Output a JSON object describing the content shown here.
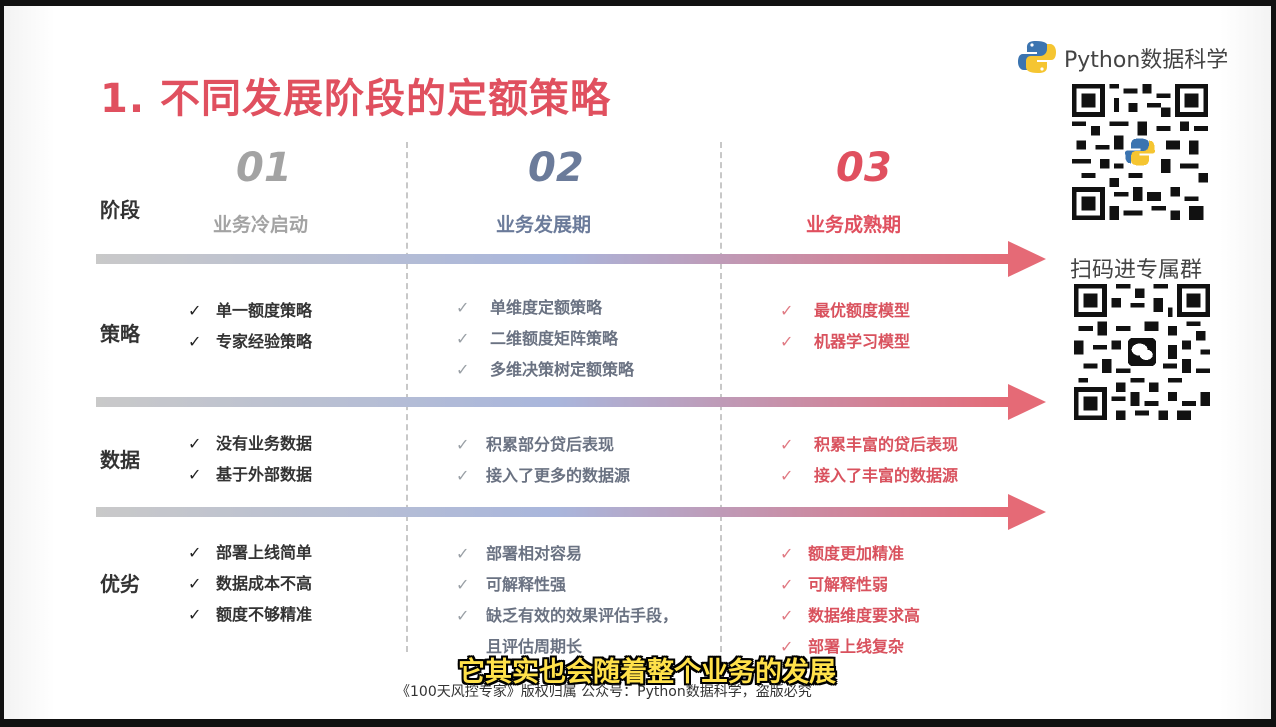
{
  "title": "1. 不同发展阶段的定额策略",
  "rows": {
    "stage": "阶段",
    "strategy": "策略",
    "data": "数据",
    "pros_cons": "优劣"
  },
  "stages": [
    {
      "num": "01",
      "name": "业务冷启动",
      "strategy": [
        "单一额度策略",
        "专家经验策略"
      ],
      "data": [
        "没有业务数据",
        "基于外部数据"
      ],
      "pros_cons": [
        "部署上线简单",
        "数据成本不高",
        "额度不够精准"
      ]
    },
    {
      "num": "02",
      "name": "业务发展期",
      "strategy": [
        "单维度定额策略",
        "二维额度矩阵策略",
        "多维决策树定额策略"
      ],
      "data": [
        "积累部分贷后表现",
        "接入了更多的数据源"
      ],
      "pros_cons": [
        "部署相对容易",
        "可解释性强",
        "缺乏有效的效果评估手段，",
        "且评估周期长"
      ]
    },
    {
      "num": "03",
      "name": "业务成熟期",
      "strategy": [
        "最优额度模型",
        "机器学习模型"
      ],
      "data": [
        "积累丰富的贷后表现",
        "接入了丰富的数据源"
      ],
      "pros_cons": [
        "额度更加精准",
        "可解释性弱",
        "数据维度要求高",
        "部署上线复杂"
      ]
    }
  ],
  "check_glyph": "✓",
  "brand": {
    "name": "Python数据科学",
    "logo_icon": "python-logo-icon"
  },
  "qr_caption": "扫码进专属群",
  "subtitle": "它其实也会随着整个业务的发展",
  "footer": "《100天风控专家》版权归属 公众号：Python数据科学，盗版必究",
  "colors": {
    "title": "#e0505f",
    "stage1": "#9a9a9a",
    "stage2": "#6b7b9a",
    "stage3": "#e0505f",
    "arrow_start": "#c9c9c9",
    "arrow_mid": "#a9b6dc",
    "arrow_end": "#e56a76",
    "subtitle": "#ffe14a"
  }
}
